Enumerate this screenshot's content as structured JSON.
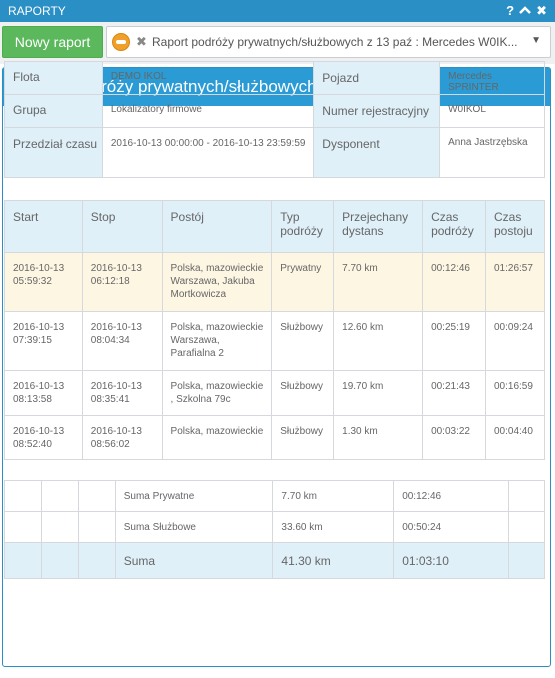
{
  "window": {
    "title": "RAPORTY",
    "controls": {
      "help": "?",
      "collapse": "^",
      "close": "✖"
    }
  },
  "toolbar": {
    "new_report_label": "Nowy raport",
    "report_selector": {
      "value": "Raport podróży prywatnych/służbowych z 13 paź : Mercedes W0IK...",
      "icon": "car-icon"
    }
  },
  "panel": {
    "title": "Raport podróży prywatnych/służbowych"
  },
  "info": {
    "flota_label": "Flota",
    "flota_value": "DEMO IKOL",
    "pojazd_label": "Pojazd",
    "pojazd_value": "Mercedes SPRINTER",
    "grupa_label": "Grupa",
    "grupa_value": "Lokalizatory firmowe",
    "numer_label": "Numer rejestracyjny",
    "numer_value": "W0IKOL",
    "przedzial_label": "Przedział czasu",
    "przedzial_value": "2016-10-13 00:00:00 - 2016-10-13 23:59:59",
    "dysponent_label": "Dysponent",
    "dysponent_value": "Anna Jastrzębska"
  },
  "trips": {
    "headers": [
      "Start",
      "Stop",
      "Postój",
      "Typ podróży",
      "Przejechany dystans",
      "Czas podróży",
      "Czas postoju"
    ],
    "rows": [
      [
        "2016-10-13 05:59:32",
        "2016-10-13 06:12:18",
        "Polska, mazowieckie Warszawa, Jakuba Mortkowicza",
        "Prywatny",
        "7.70 km",
        "00:12:46",
        "01:26:57"
      ],
      [
        "2016-10-13 07:39:15",
        "2016-10-13 08:04:34",
        "Polska, mazowieckie Warszawa, Parafialna 2",
        "Służbowy",
        "12.60 km",
        "00:25:19",
        "00:09:24"
      ],
      [
        "2016-10-13 08:13:58",
        "2016-10-13 08:35:41",
        "Polska, mazowieckie , Szkolna 79c",
        "Służbowy",
        "19.70 km",
        "00:21:43",
        "00:16:59"
      ],
      [
        "2016-10-13 08:52:40",
        "2016-10-13 08:56:02",
        "Polska, mazowieckie",
        "Służbowy",
        "1.30 km",
        "00:03:22",
        "00:04:40"
      ]
    ]
  },
  "summary": {
    "prywatne_label": "Suma Prywatne",
    "prywatne_distance": "7.70 km",
    "prywatne_time": "00:12:46",
    "sluzbowe_label": "Suma Służbowe",
    "sluzbowe_distance": "33.60 km",
    "sluzbowe_time": "00:50:24",
    "total_label": "Suma",
    "total_distance": "41.30 km",
    "total_time": "01:03:10"
  },
  "colors": {
    "accent": "#2a9bd4",
    "button_green": "#5cb85c",
    "header_cell": "#dff0f8",
    "highlight_row": "#fdf6e3"
  }
}
